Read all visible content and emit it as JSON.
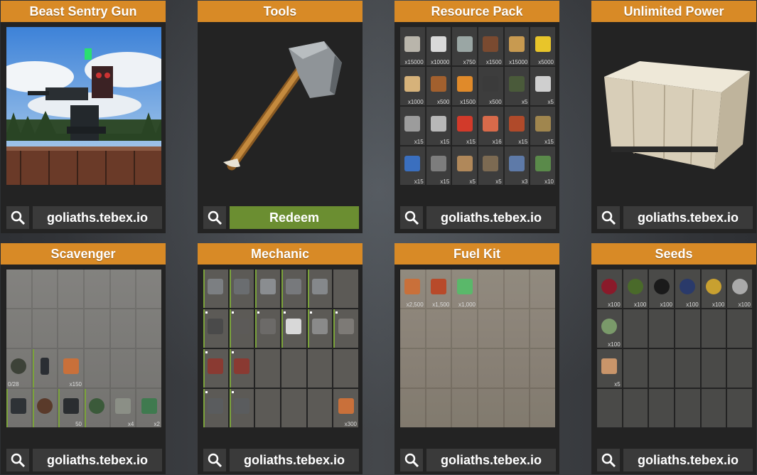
{
  "cards": [
    {
      "title": "Beast Sentry Gun",
      "url": "goliaths.tebex.io"
    },
    {
      "title": "Tools",
      "button": "Redeem"
    },
    {
      "title": "Resource Pack",
      "url": "goliaths.tebex.io",
      "items": [
        "x15000",
        "x10000",
        "x750",
        "x1500",
        "x15000",
        "x5000",
        "x1000",
        "x500",
        "x1500",
        "x500",
        "x5",
        "x5",
        "x15",
        "x15",
        "x15",
        "x16",
        "x15",
        "x15",
        "x15",
        "x15",
        "x5",
        "x5",
        "x3",
        "x10"
      ]
    },
    {
      "title": "Unlimited Power",
      "url": "goliaths.tebex.io"
    },
    {
      "title": "Scavenger",
      "url": "goliaths.tebex.io",
      "items": {
        "r3": [
          "0/28",
          "",
          "x150"
        ],
        "r4": [
          "",
          "",
          "50",
          "",
          "x4",
          "x2"
        ]
      }
    },
    {
      "title": "Mechanic",
      "url": "goliaths.tebex.io",
      "items": {
        "last": "x300"
      }
    },
    {
      "title": "Fuel Kit",
      "url": "goliaths.tebex.io",
      "items": [
        "x2,500",
        "x1,500",
        "x1,000"
      ]
    },
    {
      "title": "Seeds",
      "url": "goliaths.tebex.io",
      "items": [
        "x100",
        "x100",
        "x100",
        "x100",
        "x100",
        "x100",
        "x100",
        "x5"
      ]
    }
  ],
  "colors": {
    "header": "#d88a26",
    "button": "#3a3a3a",
    "redeem": "#6b8e31",
    "card": "#232323"
  },
  "icons": {
    "search": "magnifier-icon"
  }
}
